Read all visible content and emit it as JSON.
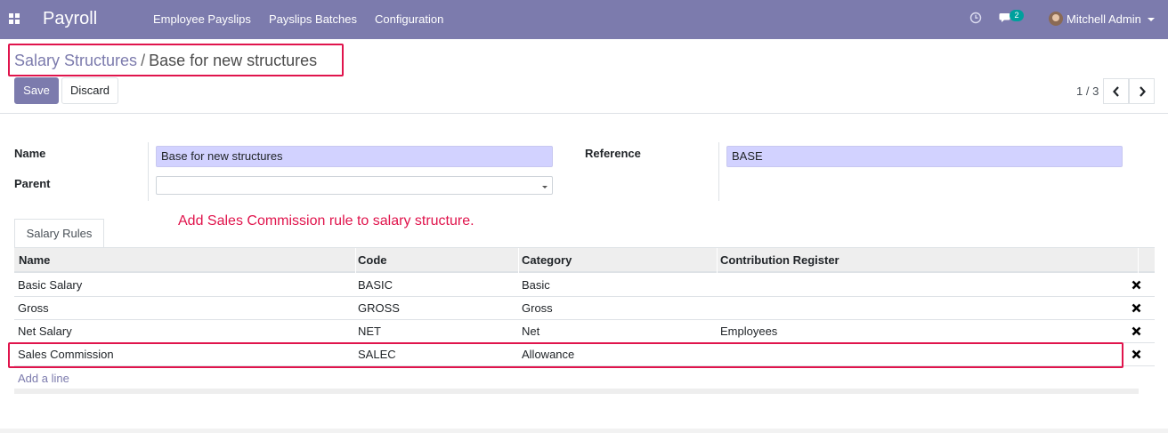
{
  "navbar": {
    "brand": "Payroll",
    "menu": [
      "Employee Payslips",
      "Payslips Batches",
      "Configuration"
    ],
    "chat_count": "2",
    "user": "Mitchell Admin",
    "bg_color": "#7c7bad"
  },
  "breadcrumb": {
    "parent": "Salary Structures",
    "separator": "/",
    "current": "Base for new structures"
  },
  "buttons": {
    "save": "Save",
    "discard": "Discard"
  },
  "pager": {
    "value": "1 / 3"
  },
  "form": {
    "name_label": "Name",
    "name_value": "Base for new structures",
    "parent_label": "Parent",
    "parent_value": "",
    "reference_label": "Reference",
    "reference_value": "BASE"
  },
  "annotation": "Add Sales Commission rule to salary structure.",
  "tabs": [
    "Salary Rules"
  ],
  "table": {
    "columns": [
      "Name",
      "Code",
      "Category",
      "Contribution Register"
    ],
    "rows": [
      [
        "Basic Salary",
        "BASIC",
        "Basic",
        ""
      ],
      [
        "Gross",
        "GROSS",
        "Gross",
        ""
      ],
      [
        "Net Salary",
        "NET",
        "Net",
        "Employees"
      ],
      [
        "Sales Commission",
        "SALEC",
        "Allowance",
        ""
      ]
    ],
    "add_line": "Add a line"
  },
  "colors": {
    "accent": "#7c7bad",
    "highlight": "#e0144c",
    "required_field": "#d2d2ff"
  },
  "icons": [
    "apps-grid-icon",
    "clock-icon",
    "chat-icon",
    "avatar",
    "chevron-left-icon",
    "chevron-right-icon",
    "trash-icon"
  ]
}
